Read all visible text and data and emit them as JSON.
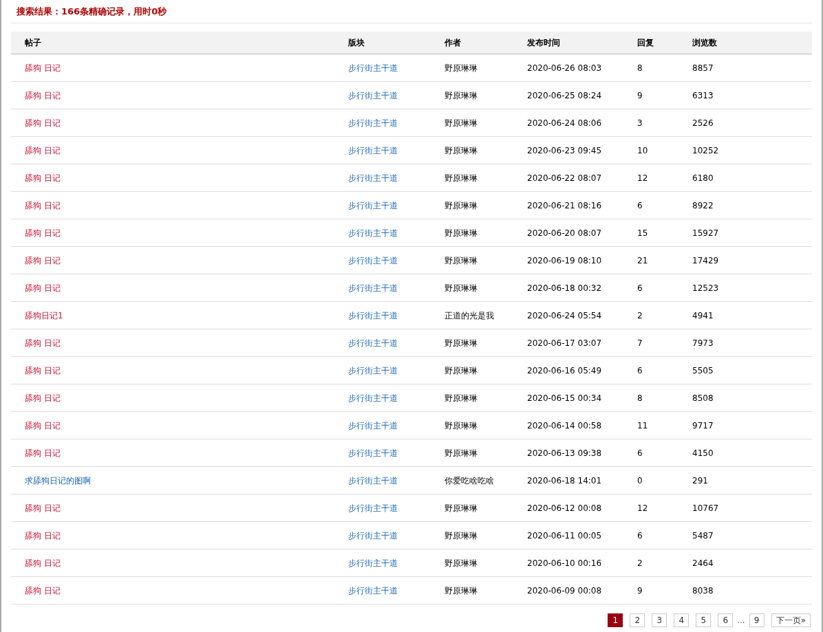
{
  "summary": "搜索结果：166条精确记录，用时0秒",
  "table": {
    "columns": [
      "帖子",
      "版块",
      "作者",
      "发布时间",
      "回复",
      "浏览数"
    ],
    "rows": [
      {
        "title": "舔狗 日记",
        "highlighted": true,
        "forum": "步行街主干道",
        "author": "野原琳琳",
        "time": "2020-06-26 08:03",
        "replies": "8",
        "views": "8857"
      },
      {
        "title": "舔狗 日记",
        "highlighted": true,
        "forum": "步行街主干道",
        "author": "野原琳琳",
        "time": "2020-06-25 08:24",
        "replies": "9",
        "views": "6313"
      },
      {
        "title": "舔狗 日记",
        "highlighted": true,
        "forum": "步行街主干道",
        "author": "野原琳琳",
        "time": "2020-06-24 08:06",
        "replies": "3",
        "views": "2526"
      },
      {
        "title": "舔狗 日记",
        "highlighted": true,
        "forum": "步行街主干道",
        "author": "野原琳琳",
        "time": "2020-06-23 09:45",
        "replies": "10",
        "views": "10252"
      },
      {
        "title": "舔狗 日记",
        "highlighted": true,
        "forum": "步行街主干道",
        "author": "野原琳琳",
        "time": "2020-06-22 08:07",
        "replies": "12",
        "views": "6180"
      },
      {
        "title": "舔狗 日记",
        "highlighted": true,
        "forum": "步行街主干道",
        "author": "野原琳琳",
        "time": "2020-06-21 08:16",
        "replies": "6",
        "views": "8922"
      },
      {
        "title": "舔狗 日记",
        "highlighted": true,
        "forum": "步行街主干道",
        "author": "野原琳琳",
        "time": "2020-06-20 08:07",
        "replies": "15",
        "views": "15927"
      },
      {
        "title": "舔狗 日记",
        "highlighted": true,
        "forum": "步行街主干道",
        "author": "野原琳琳",
        "time": "2020-06-19 08:10",
        "replies": "21",
        "views": "17429"
      },
      {
        "title": "舔狗 日记",
        "highlighted": true,
        "forum": "步行街主干道",
        "author": "野原琳琳",
        "time": "2020-06-18 00:32",
        "replies": "6",
        "views": "12523"
      },
      {
        "title": "舔狗日记1",
        "highlighted": true,
        "forum": "步行街主干道",
        "author": "正道的光是我",
        "time": "2020-06-24 05:54",
        "replies": "2",
        "views": "4941"
      },
      {
        "title": "舔狗 日记",
        "highlighted": true,
        "forum": "步行街主干道",
        "author": "野原琳琳",
        "time": "2020-06-17 03:07",
        "replies": "7",
        "views": "7973"
      },
      {
        "title": "舔狗 日记",
        "highlighted": true,
        "forum": "步行街主干道",
        "author": "野原琳琳",
        "time": "2020-06-16 05:49",
        "replies": "6",
        "views": "5505"
      },
      {
        "title": "舔狗 日记",
        "highlighted": true,
        "forum": "步行街主干道",
        "author": "野原琳琳",
        "time": "2020-06-15 00:34",
        "replies": "8",
        "views": "8508"
      },
      {
        "title": "舔狗 日记",
        "highlighted": true,
        "forum": "步行街主干道",
        "author": "野原琳琳",
        "time": "2020-06-14 00:58",
        "replies": "11",
        "views": "9717"
      },
      {
        "title": "舔狗 日记",
        "highlighted": true,
        "forum": "步行街主干道",
        "author": "野原琳琳",
        "time": "2020-06-13 09:38",
        "replies": "6",
        "views": "4150"
      },
      {
        "title": "求舔狗日记的图啊",
        "highlighted": false,
        "forum": "步行街主干道",
        "author": "你爱吃啥吃啥",
        "time": "2020-06-18 14:01",
        "replies": "0",
        "views": "291"
      },
      {
        "title": "舔狗 日记",
        "highlighted": true,
        "forum": "步行街主干道",
        "author": "野原琳琳",
        "time": "2020-06-12 00:08",
        "replies": "12",
        "views": "10767"
      },
      {
        "title": "舔狗 日记",
        "highlighted": true,
        "forum": "步行街主干道",
        "author": "野原琳琳",
        "time": "2020-06-11 00:05",
        "replies": "6",
        "views": "5487"
      },
      {
        "title": "舔狗 日记",
        "highlighted": true,
        "forum": "步行街主干道",
        "author": "野原琳琳",
        "time": "2020-06-10 00:16",
        "replies": "2",
        "views": "2464"
      },
      {
        "title": "舔狗 日记",
        "highlighted": true,
        "forum": "步行街主干道",
        "author": "野原琳琳",
        "time": "2020-06-09 00:08",
        "replies": "9",
        "views": "8038"
      }
    ]
  },
  "pagination": {
    "pages": [
      {
        "label": "1",
        "selected": true
      },
      {
        "label": "2",
        "selected": false
      },
      {
        "label": "3",
        "selected": false
      },
      {
        "label": "4",
        "selected": false
      },
      {
        "label": "5",
        "selected": false
      },
      {
        "label": "6",
        "selected": false
      }
    ],
    "ellipsis": "...",
    "last": "9",
    "next": "下一页»"
  }
}
